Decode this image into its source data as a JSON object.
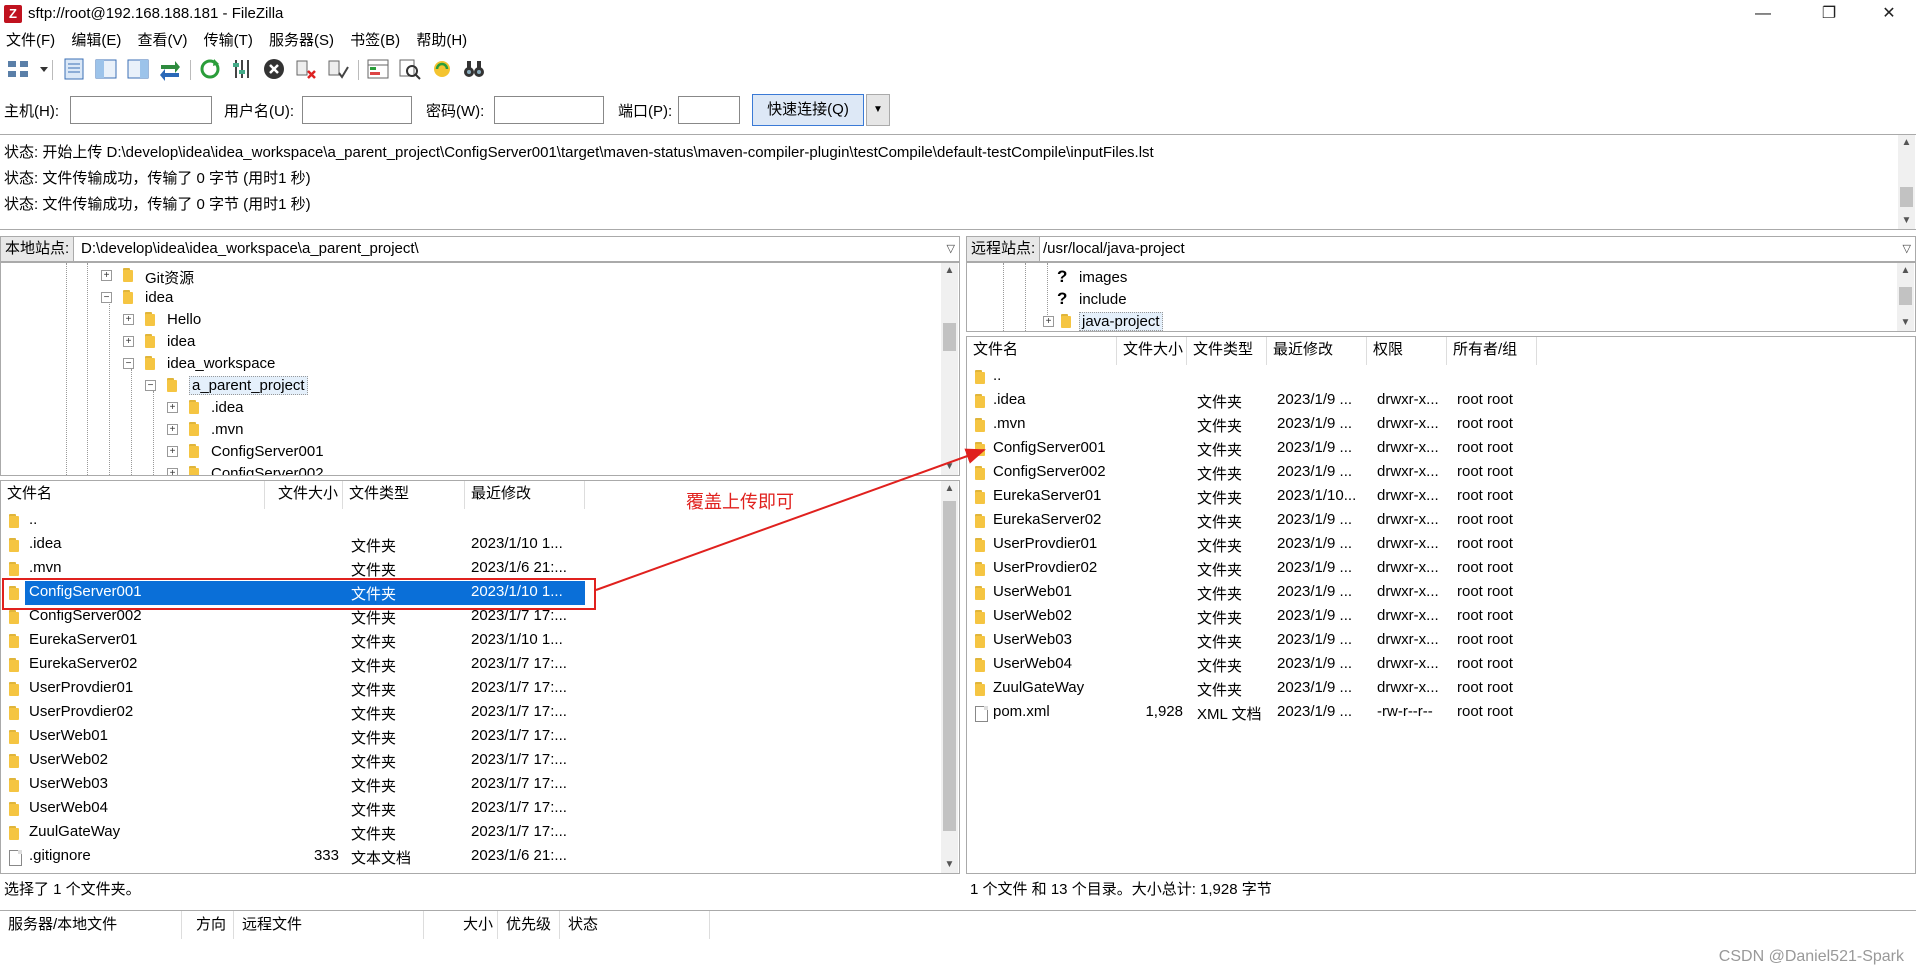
{
  "window": {
    "title": "sftp://root@192.168.188.181 - FileZilla",
    "icon": "filezilla-icon",
    "minimize": "—",
    "maximize": "❐",
    "close": "✕"
  },
  "menu": [
    "文件(F)",
    "编辑(E)",
    "查看(V)",
    "传输(T)",
    "服务器(S)",
    "书签(B)",
    "帮助(H)"
  ],
  "quickconnect": {
    "host_label": "主机(H):",
    "user_label": "用户名(U):",
    "pass_label": "密码(W):",
    "port_label": "端口(P):",
    "host_value": "",
    "user_value": "",
    "pass_value": "",
    "port_value": "",
    "button": "快速连接(Q)",
    "dropdown": "▼"
  },
  "log": [
    "状态:  开始上传 D:\\develop\\idea\\idea_workspace\\a_parent_project\\ConfigServer001\\target\\maven-status\\maven-compiler-plugin\\testCompile\\default-testCompile\\inputFiles.lst",
    "状态:  文件传输成功，传输了 0 字节 (用时1 秒)",
    "状态:  文件传输成功，传输了 0 字节 (用时1 秒)"
  ],
  "local": {
    "site_label": "本地站点:",
    "path": "D:\\develop\\idea\\idea_workspace\\a_parent_project\\",
    "tree": [
      "Git资源",
      "idea",
      "Hello",
      "idea",
      "idea_workspace",
      "a_parent_project",
      ".idea",
      ".mvn",
      "ConfigServer001",
      "ConfigServer002"
    ],
    "columns": [
      "文件名",
      "文件大小",
      "文件类型",
      "最近修改"
    ],
    "files": [
      {
        "name": "..",
        "size": "",
        "type": "",
        "modified": ""
      },
      {
        "name": ".idea",
        "size": "",
        "type": "文件夹",
        "modified": "2023/1/10 1..."
      },
      {
        "name": ".mvn",
        "size": "",
        "type": "文件夹",
        "modified": "2023/1/6 21:..."
      },
      {
        "name": "ConfigServer001",
        "size": "",
        "type": "文件夹",
        "modified": "2023/1/10 1..."
      },
      {
        "name": "ConfigServer002",
        "size": "",
        "type": "文件夹",
        "modified": "2023/1/7 17:..."
      },
      {
        "name": "EurekaServer01",
        "size": "",
        "type": "文件夹",
        "modified": "2023/1/10 1..."
      },
      {
        "name": "EurekaServer02",
        "size": "",
        "type": "文件夹",
        "modified": "2023/1/7 17:..."
      },
      {
        "name": "UserProvdier01",
        "size": "",
        "type": "文件夹",
        "modified": "2023/1/7 17:..."
      },
      {
        "name": "UserProvdier02",
        "size": "",
        "type": "文件夹",
        "modified": "2023/1/7 17:..."
      },
      {
        "name": "UserWeb01",
        "size": "",
        "type": "文件夹",
        "modified": "2023/1/7 17:..."
      },
      {
        "name": "UserWeb02",
        "size": "",
        "type": "文件夹",
        "modified": "2023/1/7 17:..."
      },
      {
        "name": "UserWeb03",
        "size": "",
        "type": "文件夹",
        "modified": "2023/1/7 17:..."
      },
      {
        "name": "UserWeb04",
        "size": "",
        "type": "文件夹",
        "modified": "2023/1/7 17:..."
      },
      {
        "name": "ZuulGateWay",
        "size": "",
        "type": "文件夹",
        "modified": "2023/1/7 17:..."
      },
      {
        "name": ".gitignore",
        "size": "333",
        "type": "文本文档",
        "modified": "2023/1/6 21:..."
      }
    ],
    "status": "选择了 1 个文件夹。"
  },
  "remote": {
    "site_label": "远程站点:",
    "path": "/usr/local/java-project",
    "tree": [
      "images",
      "include",
      "java-project"
    ],
    "columns": [
      "文件名",
      "文件大小",
      "文件类型",
      "最近修改",
      "权限",
      "所有者/组"
    ],
    "files": [
      {
        "name": "..",
        "size": "",
        "type": "",
        "modified": "",
        "perm": "",
        "owner": ""
      },
      {
        "name": ".idea",
        "size": "",
        "type": "文件夹",
        "modified": "2023/1/9 ...",
        "perm": "drwxr-x...",
        "owner": "root root"
      },
      {
        "name": ".mvn",
        "size": "",
        "type": "文件夹",
        "modified": "2023/1/9 ...",
        "perm": "drwxr-x...",
        "owner": "root root"
      },
      {
        "name": "ConfigServer001",
        "size": "",
        "type": "文件夹",
        "modified": "2023/1/9 ...",
        "perm": "drwxr-x...",
        "owner": "root root"
      },
      {
        "name": "ConfigServer002",
        "size": "",
        "type": "文件夹",
        "modified": "2023/1/9 ...",
        "perm": "drwxr-x...",
        "owner": "root root"
      },
      {
        "name": "EurekaServer01",
        "size": "",
        "type": "文件夹",
        "modified": "2023/1/10...",
        "perm": "drwxr-x...",
        "owner": "root root"
      },
      {
        "name": "EurekaServer02",
        "size": "",
        "type": "文件夹",
        "modified": "2023/1/9 ...",
        "perm": "drwxr-x...",
        "owner": "root root"
      },
      {
        "name": "UserProvdier01",
        "size": "",
        "type": "文件夹",
        "modified": "2023/1/9 ...",
        "perm": "drwxr-x...",
        "owner": "root root"
      },
      {
        "name": "UserProvdier02",
        "size": "",
        "type": "文件夹",
        "modified": "2023/1/9 ...",
        "perm": "drwxr-x...",
        "owner": "root root"
      },
      {
        "name": "UserWeb01",
        "size": "",
        "type": "文件夹",
        "modified": "2023/1/9 ...",
        "perm": "drwxr-x...",
        "owner": "root root"
      },
      {
        "name": "UserWeb02",
        "size": "",
        "type": "文件夹",
        "modified": "2023/1/9 ...",
        "perm": "drwxr-x...",
        "owner": "root root"
      },
      {
        "name": "UserWeb03",
        "size": "",
        "type": "文件夹",
        "modified": "2023/1/9 ...",
        "perm": "drwxr-x...",
        "owner": "root root"
      },
      {
        "name": "UserWeb04",
        "size": "",
        "type": "文件夹",
        "modified": "2023/1/9 ...",
        "perm": "drwxr-x...",
        "owner": "root root"
      },
      {
        "name": "ZuulGateWay",
        "size": "",
        "type": "文件夹",
        "modified": "2023/1/9 ...",
        "perm": "drwxr-x...",
        "owner": "root root"
      },
      {
        "name": "pom.xml",
        "size": "1,928",
        "type": "XML 文档",
        "modified": "2023/1/9 ...",
        "perm": "-rw-r--r--",
        "owner": "root root"
      }
    ],
    "status": "1 个文件 和 13 个目录。大小总计: 1,928 字节"
  },
  "queue": {
    "columns": [
      "服务器/本地文件",
      "方向",
      "远程文件",
      "大小",
      "优先级",
      "状态"
    ]
  },
  "annotation": "覆盖上传即可",
  "watermark": "CSDN @Daniel521-Spark",
  "colors": {
    "selection": "#0a6fd8",
    "annotation": "#e0211e",
    "folder": "#f5c542"
  }
}
